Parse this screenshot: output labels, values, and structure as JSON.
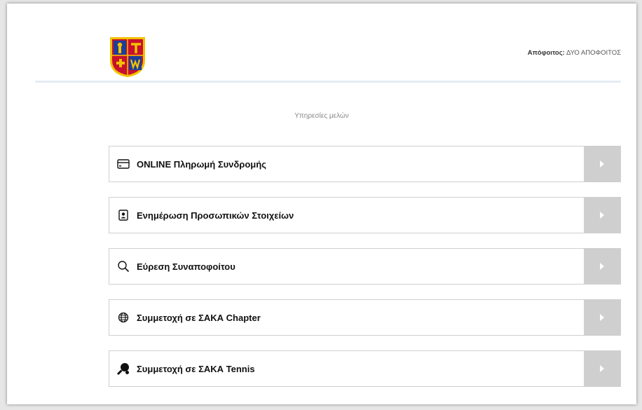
{
  "header": {
    "user_label": "Απόφοιτος:",
    "user_name": "ΔΥΟ ΑΠΟΦΟΙΤΟΣ"
  },
  "main": {
    "section_title": "Υπηρεσίες μελών",
    "items": [
      {
        "label": "ONLINE Πληρωμή Συνδρομής",
        "icon": "credit-card-icon"
      },
      {
        "label": "Ενημέρωση Προσωπικών Στοιχείων",
        "icon": "id-badge-icon"
      },
      {
        "label": "Εύρεση Συναποφοίτου",
        "icon": "search-icon"
      },
      {
        "label": "Συμμετοχή σε ΣΑΚΑ Chapter",
        "icon": "globe-icon"
      },
      {
        "label": "Συμμετοχή σε ΣΑΚΑ Tennis",
        "icon": "tennis-racket-icon"
      }
    ]
  },
  "colors": {
    "arrow_bg": "#cfcfcf",
    "border": "#cfcfcf",
    "crest_red": "#c8102e",
    "crest_blue": "#1f3d99",
    "crest_gold": "#f2c200"
  }
}
